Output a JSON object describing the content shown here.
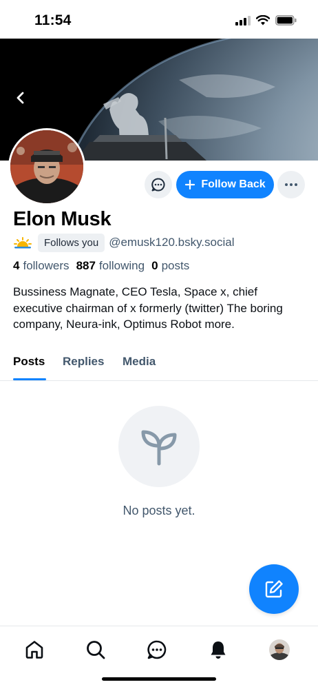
{
  "status_bar": {
    "time": "11:54"
  },
  "profile": {
    "display_name": "Elon Musk",
    "follows_you_label": "Follows you",
    "handle": "@emusk120.bsky.social",
    "stats": {
      "followers_count": "4",
      "followers_label": "followers",
      "following_count": "887",
      "following_label": "following",
      "posts_count": "0",
      "posts_label": "posts"
    },
    "bio": "Bussiness Magnate, CEO Tesla, Space x, chief executive chairman of x formerly (twitter) The boring company, Neura-ink, Optimus Robot more."
  },
  "actions": {
    "follow_back_label": "Follow Back"
  },
  "tabs": [
    {
      "label": "Posts",
      "active": true
    },
    {
      "label": "Replies",
      "active": false
    },
    {
      "label": "Media",
      "active": false
    }
  ],
  "empty_state": {
    "message": "No posts yet."
  },
  "colors": {
    "accent": "#1083fe",
    "muted_text": "#42576c",
    "button_bg": "#edf0f3"
  },
  "icons": {
    "back": "chevron-left-icon",
    "message": "chat-bubble-icon",
    "follow": "plus-icon",
    "more": "ellipsis-icon",
    "empty": "sprout-icon",
    "compose": "edit-icon",
    "nav": [
      "home-icon",
      "search-icon",
      "chat-icon",
      "bell-icon",
      "profile-avatar"
    ]
  }
}
